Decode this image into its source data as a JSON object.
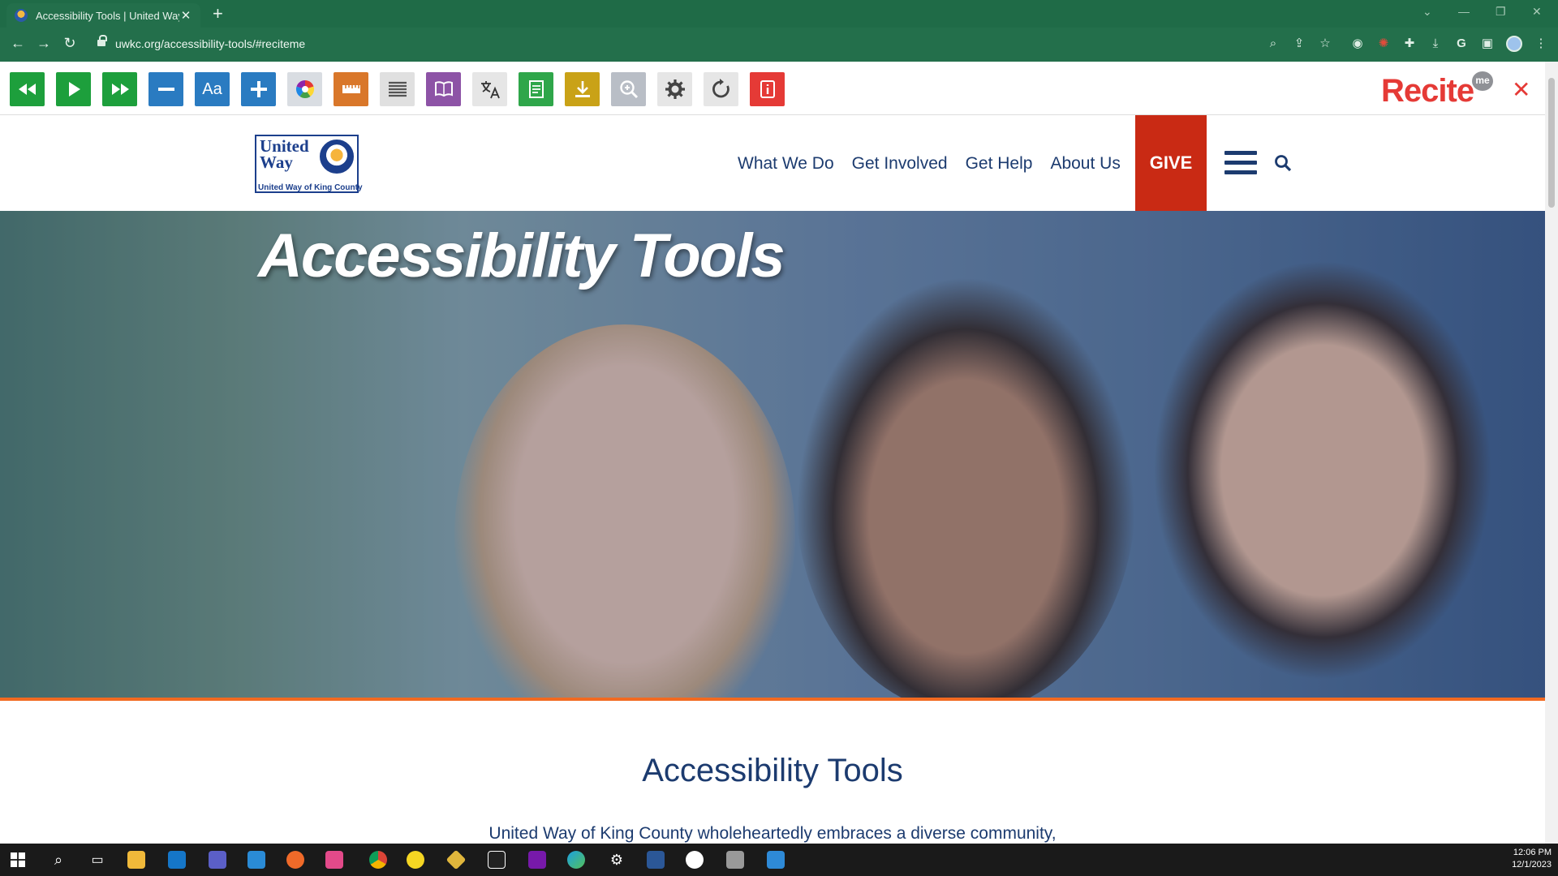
{
  "browser": {
    "tab_title": "Accessibility Tools | United Way",
    "url": "uwkc.org/accessibility-tools/#reciteme"
  },
  "recite": {
    "logo": "Recite",
    "logo_badge": "me",
    "buttons": [
      {
        "name": "rewind",
        "color": "#1d9f3c"
      },
      {
        "name": "play",
        "color": "#1d9f3c"
      },
      {
        "name": "fast-forward",
        "color": "#1d9f3c"
      },
      {
        "name": "decrease-text",
        "color": "#2a7bc1"
      },
      {
        "name": "font",
        "color": "#2a7bc1",
        "label": "Aa"
      },
      {
        "name": "increase-text",
        "color": "#2a7bc1"
      },
      {
        "name": "color-wheel",
        "color": "#d9dde2"
      },
      {
        "name": "ruler",
        "color": "#d9772a"
      },
      {
        "name": "screen-mask",
        "color": "#8f9196"
      },
      {
        "name": "dictionary",
        "color": "#8d53a6"
      },
      {
        "name": "translate",
        "color": "#6c7077"
      },
      {
        "name": "text-only",
        "color": "#2fa64a"
      },
      {
        "name": "download",
        "color": "#c9a217"
      },
      {
        "name": "magnifier",
        "color": "#b9bec6"
      },
      {
        "name": "settings",
        "color": "#73777d"
      },
      {
        "name": "reset",
        "color": "#73777d"
      },
      {
        "name": "user-guide",
        "color": "#e53a36"
      }
    ]
  },
  "header": {
    "logo_text": "United Way",
    "logo_sub": "United Way of King County",
    "nav": [
      "What We Do",
      "Get Involved",
      "Get Help",
      "About Us"
    ],
    "give": "GIVE"
  },
  "hero": {
    "title": "Accessibility Tools"
  },
  "content": {
    "title": "Accessibility Tools",
    "intro": "United Way of King County wholeheartedly embraces a diverse community,"
  },
  "taskbar": {
    "time": "12:06 PM",
    "date": "12/1/2023"
  }
}
